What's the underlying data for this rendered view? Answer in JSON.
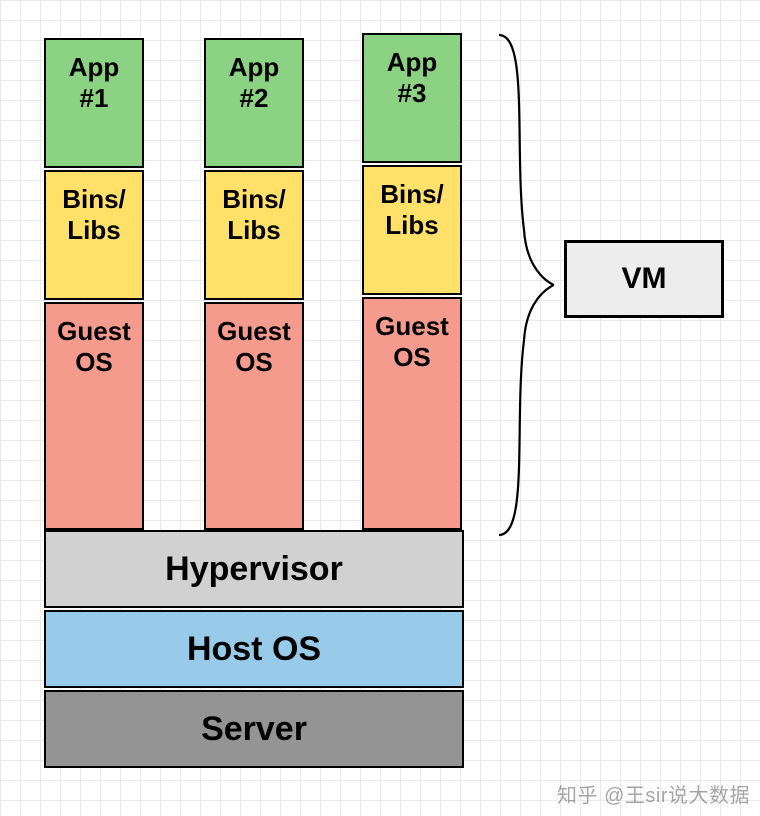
{
  "columns": [
    {
      "app": "App\n#1",
      "bins": "Bins/\nLibs",
      "guest": "Guest\nOS"
    },
    {
      "app": "App\n#2",
      "bins": "Bins/\nLibs",
      "guest": "Guest\nOS"
    },
    {
      "app": "App\n#3",
      "bins": "Bins/\nLibs",
      "guest": "Guest\nOS"
    }
  ],
  "base": {
    "hypervisor": "Hypervisor",
    "host_os": "Host OS",
    "server": "Server"
  },
  "vm_label": "VM",
  "watermark": "知乎 @王sir说大数据",
  "colors": {
    "app": "#8bd282",
    "bins": "#ffe169",
    "guest": "#f49b8e",
    "hypervisor": "#d1d1d1",
    "host_os": "#97cbe9",
    "server": "#949494",
    "vm": "#ededed"
  }
}
